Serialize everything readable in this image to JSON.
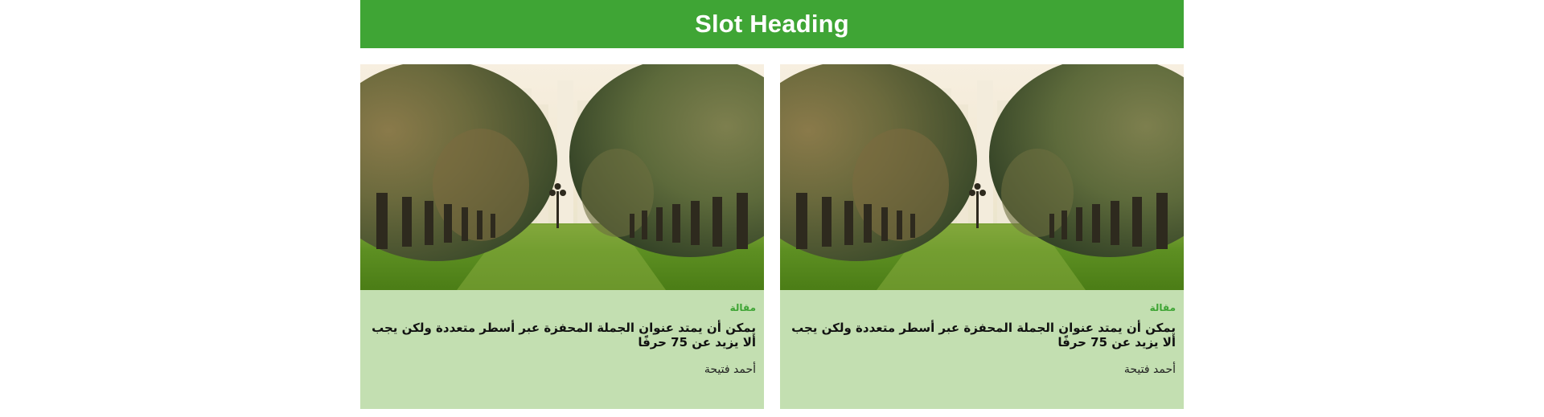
{
  "slot": {
    "heading": "Slot Heading",
    "accent_color": "#3fa535",
    "card_background": "#c3dfb1"
  },
  "cards": [
    {
      "image": "palm-tree-avenue-photo",
      "kicker": "مقالة",
      "title": "يمكن أن يمتد عنوان الجملة المحفزة عبر أسطر متعددة ولكن يجب ألا يزيد عن 75 حرفًا",
      "author": "أحمد فتيحة"
    },
    {
      "image": "palm-tree-avenue-photo",
      "kicker": "مقالة",
      "title": "يمكن أن يمتد عنوان الجملة المحفزة عبر أسطر متعددة ولكن يجب ألا يزيد عن 75 حرفًا",
      "author": "أحمد فتيحة"
    }
  ]
}
